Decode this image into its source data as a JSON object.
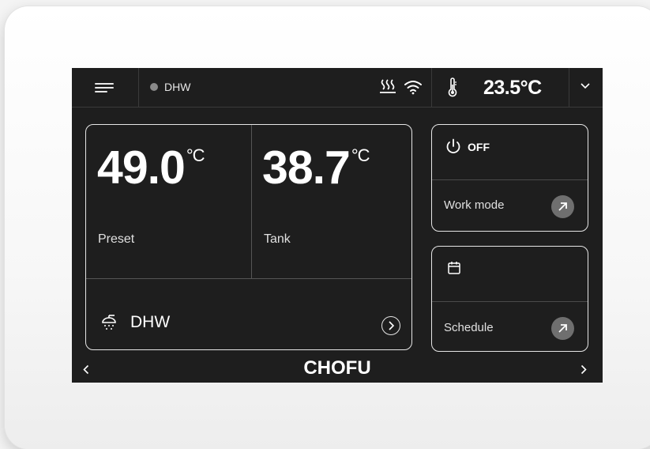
{
  "topbar": {
    "menu_icon": "hamburger-icon",
    "mode_indicator_color": "#8a8a8a",
    "mode_label": "DHW",
    "heating_icon": "heating-icon",
    "wifi_icon": "wifi-icon",
    "thermometer_icon": "thermometer-icon",
    "room_temperature": "23.5°C",
    "dropdown_icon": "chevron-down-icon"
  },
  "main_card": {
    "preset_value": "49.0",
    "preset_unit": "°C",
    "preset_label": "Preset",
    "tank_value": "38.7",
    "tank_unit": "°C",
    "tank_label": "Tank",
    "dhw_icon": "shower-icon",
    "dhw_label": "DHW",
    "dhw_arrow_icon": "chevron-right-circle-icon"
  },
  "power_card": {
    "icon": "power-icon",
    "state": "OFF",
    "label": "Work mode",
    "action_icon": "arrow-up-right-icon"
  },
  "schedule_card": {
    "icon": "calendar-icon",
    "label": "Schedule",
    "action_icon": "arrow-up-right-icon"
  },
  "footer": {
    "brand": "CHOFU",
    "prev_icon": "chevron-left-icon",
    "next_icon": "chevron-right-icon"
  },
  "colors": {
    "screen_background": "#1e1e1e",
    "card_border": "#e6e6e6",
    "action_button": "#6f6f6f",
    "bezel": "#f7f7f7"
  }
}
